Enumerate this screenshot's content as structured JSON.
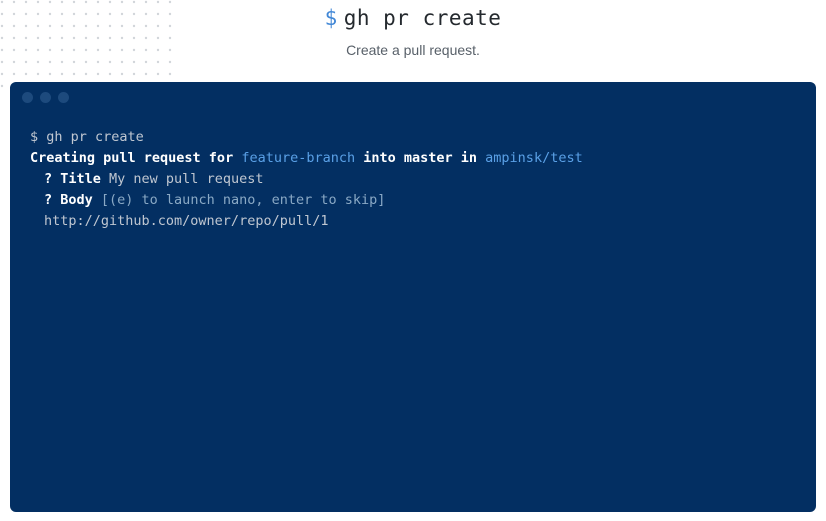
{
  "header": {
    "prompt": "$",
    "command": "gh pr create",
    "description": "Create a pull request."
  },
  "terminal": {
    "prompt_line": "$ gh pr create",
    "status": {
      "prefix": "Creating pull request for ",
      "source_branch": "feature-branch",
      "middle": " into master in ",
      "repo": "ampinsk/test"
    },
    "title_prompt": "? Title",
    "title_value": " My new pull request",
    "body_prompt": "? Body",
    "body_hint": " [(e) to launch nano, enter to skip]",
    "url": "http://github.com/owner/repo/pull/1"
  }
}
